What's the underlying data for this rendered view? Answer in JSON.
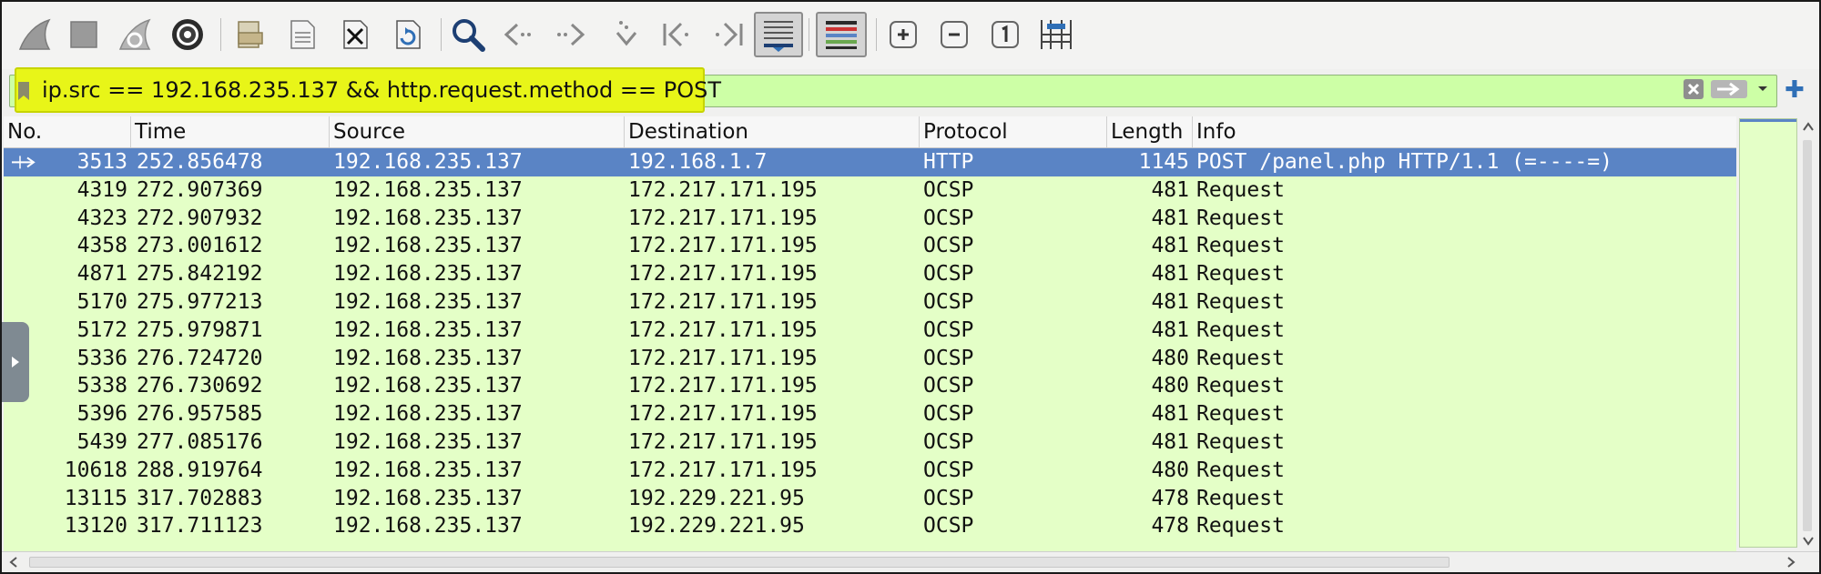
{
  "toolbar": {
    "icons": [
      "shark-fin-start-icon",
      "stop-square-icon",
      "restart-shark-fin-icon",
      "capture-options-gear-icon",
      "open-file-icon",
      "file-set-icon",
      "close-file-icon",
      "reload-icon",
      "search-icon",
      "go-back-icon",
      "go-forward-icon",
      "go-to-packet-icon",
      "first-packet-icon",
      "last-packet-icon",
      "autoscroll-icon",
      "colorize-icon",
      "zoom-in-icon",
      "zoom-out-icon",
      "normal-size-icon",
      "resize-columns-icon"
    ]
  },
  "filter": {
    "value": "ip.src == 192.168.235.137 && http.request.method == POST",
    "highlight_color": "#e8f518",
    "valid_color": "#cdffa6"
  },
  "columns": [
    "No.",
    "Time",
    "Source",
    "Destination",
    "Protocol",
    "Length",
    "Info"
  ],
  "packets": [
    {
      "no": "3513",
      "time": "252.856478",
      "src": "192.168.235.137",
      "dst": "192.168.1.7",
      "proto": "HTTP",
      "len": "1145",
      "info": "POST /panel.php HTTP/1.1  (=----=)",
      "selected": true
    },
    {
      "no": "4319",
      "time": "272.907369",
      "src": "192.168.235.137",
      "dst": "172.217.171.195",
      "proto": "OCSP",
      "len": "481",
      "info": "Request"
    },
    {
      "no": "4323",
      "time": "272.907932",
      "src": "192.168.235.137",
      "dst": "172.217.171.195",
      "proto": "OCSP",
      "len": "481",
      "info": "Request"
    },
    {
      "no": "4358",
      "time": "273.001612",
      "src": "192.168.235.137",
      "dst": "172.217.171.195",
      "proto": "OCSP",
      "len": "481",
      "info": "Request"
    },
    {
      "no": "4871",
      "time": "275.842192",
      "src": "192.168.235.137",
      "dst": "172.217.171.195",
      "proto": "OCSP",
      "len": "481",
      "info": "Request"
    },
    {
      "no": "5170",
      "time": "275.977213",
      "src": "192.168.235.137",
      "dst": "172.217.171.195",
      "proto": "OCSP",
      "len": "481",
      "info": "Request"
    },
    {
      "no": "5172",
      "time": "275.979871",
      "src": "192.168.235.137",
      "dst": "172.217.171.195",
      "proto": "OCSP",
      "len": "481",
      "info": "Request"
    },
    {
      "no": "5336",
      "time": "276.724720",
      "src": "192.168.235.137",
      "dst": "172.217.171.195",
      "proto": "OCSP",
      "len": "480",
      "info": "Request"
    },
    {
      "no": "5338",
      "time": "276.730692",
      "src": "192.168.235.137",
      "dst": "172.217.171.195",
      "proto": "OCSP",
      "len": "480",
      "info": "Request"
    },
    {
      "no": "5396",
      "time": "276.957585",
      "src": "192.168.235.137",
      "dst": "172.217.171.195",
      "proto": "OCSP",
      "len": "481",
      "info": "Request"
    },
    {
      "no": "5439",
      "time": "277.085176",
      "src": "192.168.235.137",
      "dst": "172.217.171.195",
      "proto": "OCSP",
      "len": "481",
      "info": "Request"
    },
    {
      "no": "10618",
      "time": "288.919764",
      "src": "192.168.235.137",
      "dst": "172.217.171.195",
      "proto": "OCSP",
      "len": "480",
      "info": "Request"
    },
    {
      "no": "13115",
      "time": "317.702883",
      "src": "192.168.235.137",
      "dst": "192.229.221.95",
      "proto": "OCSP",
      "len": "478",
      "info": "Request"
    },
    {
      "no": "13120",
      "time": "317.711123",
      "src": "192.168.235.137",
      "dst": "192.229.221.95",
      "proto": "OCSP",
      "len": "478",
      "info": "Request"
    }
  ],
  "colors": {
    "row_bg": "#e4ffc7",
    "selected_row": "#5a84c5",
    "accent": "#2f6fb6"
  }
}
